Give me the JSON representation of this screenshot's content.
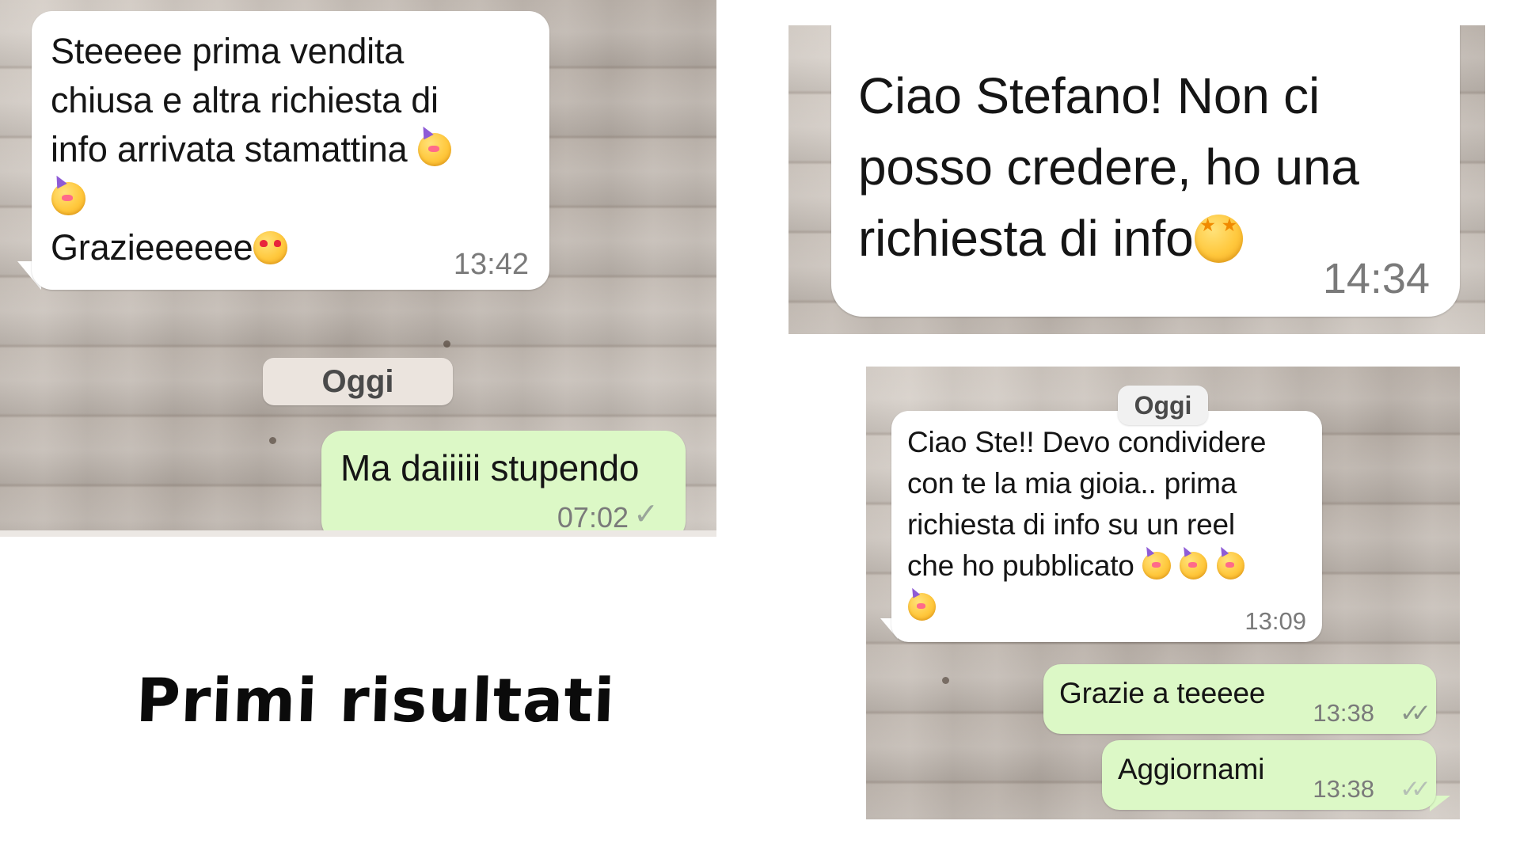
{
  "panel1": {
    "incoming": {
      "lines": [
        "Steeeee prima vendita",
        "chiusa e altra richiesta di",
        "info arrivata stamattina"
      ],
      "emoji_line1": [
        "partying-face-emoji"
      ],
      "emoji_line2": [
        "partying-face-emoji"
      ],
      "last_line": "Grazieeeeee",
      "last_emoji": "heart-eyes-emoji",
      "time": "13:42"
    },
    "date_separator": "Oggi",
    "outgoing": {
      "text": "Ma daiiiii stupendo",
      "time": "07:02",
      "status": "single-check-icon"
    }
  },
  "panel2": {
    "incoming": {
      "lines": [
        "Ciao Stefano! Non ci",
        "posso credere, ho una",
        "richiesta di info"
      ],
      "emoji": "star-struck-emoji",
      "time": "14:34"
    }
  },
  "panel3": {
    "date_separator": "Oggi",
    "incoming": {
      "lines": [
        "Ciao Ste!! Devo condividere",
        "con te la mia gioia.. prima",
        "richiesta di info su un reel",
        "che ho pubblicato"
      ],
      "emoji": "partying-face-emoji",
      "time": "13:09"
    },
    "outgoing": [
      {
        "text": "Grazie a teeeee",
        "time": "13:38",
        "status": "double-check-icon"
      },
      {
        "text": "Aggiornami",
        "time": "13:38",
        "status": "double-check-icon"
      }
    ]
  },
  "caption": "Primi risultati",
  "colors": {
    "incoming_bubble": "#ffffff",
    "outgoing_bubble": "#dcf8c6",
    "wood_background": "#c9c0b8",
    "timestamp": "#7a7a7a"
  }
}
